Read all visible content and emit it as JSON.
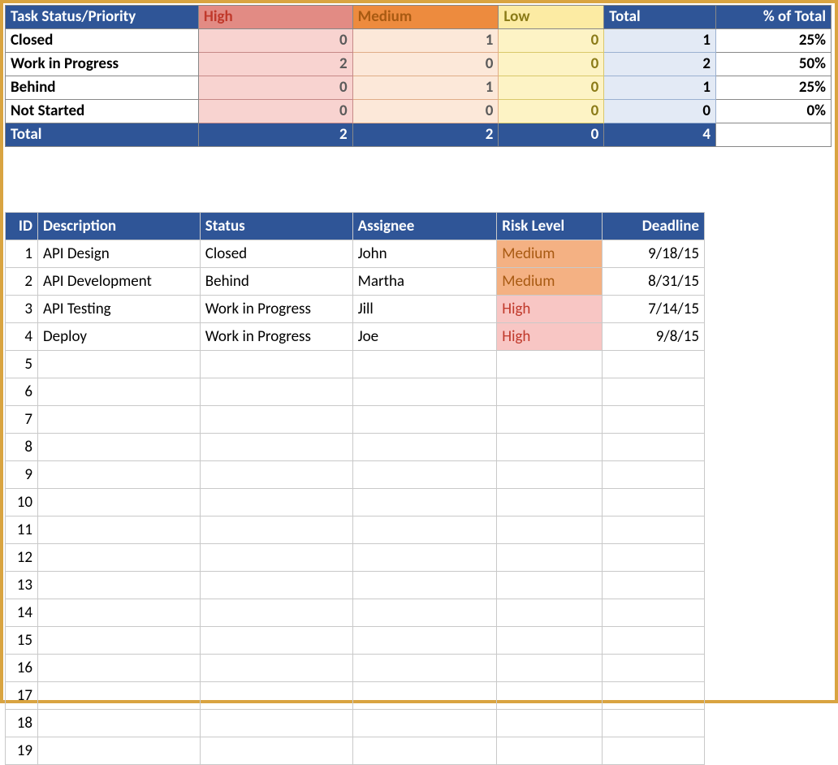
{
  "pivot": {
    "headers": {
      "task_status_priority": "Task Status/Priority",
      "high": "High",
      "medium": "Medium",
      "low": "Low",
      "total": "Total",
      "pct_of_total": "% of Total"
    },
    "rows": [
      {
        "label": "Closed",
        "high": "0",
        "med": "1",
        "low": "0",
        "total": "1",
        "pct": "25%"
      },
      {
        "label": "Work in Progress",
        "high": "2",
        "med": "0",
        "low": "0",
        "total": "2",
        "pct": "50%"
      },
      {
        "label": "Behind",
        "high": "0",
        "med": "1",
        "low": "0",
        "total": "1",
        "pct": "25%"
      },
      {
        "label": "Not Started",
        "high": "0",
        "med": "0",
        "low": "0",
        "total": "0",
        "pct": "0%"
      }
    ],
    "footer": {
      "label": "Total",
      "high": "2",
      "med": "2",
      "low": "0",
      "total": "4",
      "pct": ""
    }
  },
  "tasks": {
    "headers": {
      "id": "ID",
      "description": "Description",
      "status": "Status",
      "assignee": "Assignee",
      "risk_level": "Risk Level",
      "deadline": "Deadline"
    },
    "rows": [
      {
        "id": "1",
        "description": "API Design",
        "status": "Closed",
        "assignee": "John",
        "risk_level": "Medium",
        "risk_class": "risk-medium",
        "deadline": "9/18/15"
      },
      {
        "id": "2",
        "description": "API Development",
        "status": "Behind",
        "assignee": "Martha",
        "risk_level": "Medium",
        "risk_class": "risk-medium",
        "deadline": "8/31/15"
      },
      {
        "id": "3",
        "description": "API Testing",
        "status": "Work in Progress",
        "assignee": "Jill",
        "risk_level": "High",
        "risk_class": "risk-high",
        "deadline": "7/14/15"
      },
      {
        "id": "4",
        "description": "Deploy",
        "status": "Work in Progress",
        "assignee": "Joe",
        "risk_level": "High",
        "risk_class": "risk-high",
        "deadline": "9/8/15"
      }
    ],
    "empty_row_count": 15,
    "first_empty_id": 5
  }
}
